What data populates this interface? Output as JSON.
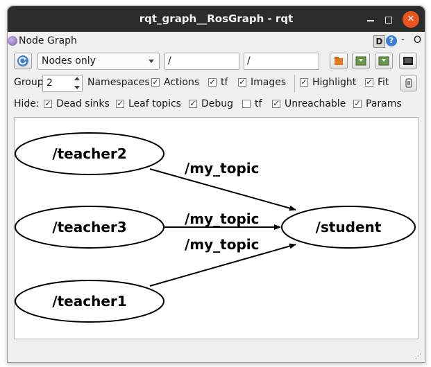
{
  "window": {
    "title": "rqt_graph__RosGraph - rqt",
    "minimize_glyph": "",
    "maximize_glyph": "",
    "close_glyph": "✕"
  },
  "plugin": {
    "title": "Node Graph",
    "icon": "node-graph-icon",
    "d_label": "D",
    "help_label": "?",
    "dash_label": "-",
    "close_label": "O"
  },
  "toolbar": {
    "refresh_icon": "refresh-icon",
    "mode_value": "Nodes only",
    "node_filter_value": "/",
    "topic_filter_value": "/",
    "buttons": [
      "load-dot-icon",
      "save-dot-icon",
      "save-svg-icon",
      "save-image-icon"
    ]
  },
  "group_row": {
    "group_label": "Group:",
    "group_value": "2",
    "namespaces": {
      "label": "Namespaces",
      "checked": true
    },
    "actions": {
      "label": "Actions",
      "checked": true
    },
    "tf": {
      "label": "tf",
      "checked": true
    },
    "images": {
      "label": "Images",
      "checked": true
    },
    "highlight": {
      "label": "Highlight",
      "checked": true
    },
    "fit": {
      "label": "Fit",
      "checked": true
    },
    "fit_button_icon": "fit-in-view-icon"
  },
  "hide_row": {
    "hide_label": "Hide:",
    "dead_sinks": {
      "label": "Dead sinks",
      "checked": true
    },
    "leaf_topics": {
      "label": "Leaf topics",
      "checked": true
    },
    "debug": {
      "label": "Debug",
      "checked": true
    },
    "tf": {
      "label": "tf",
      "checked": false
    },
    "unreachable": {
      "label": "Unreachable",
      "checked": true
    },
    "params": {
      "label": "Params",
      "checked": true
    }
  },
  "graph": {
    "nodes": [
      "/teacher2",
      "/teacher3",
      "/teacher1",
      "/student"
    ],
    "edges": [
      {
        "from": "/teacher2",
        "to": "/student",
        "label": "/my_topic"
      },
      {
        "from": "/teacher3",
        "to": "/student",
        "label": "/my_topic"
      },
      {
        "from": "/teacher1",
        "to": "/student",
        "label": "/my_topic"
      }
    ]
  },
  "checkmark": "✓",
  "colors": {
    "titlebar": "#2c2c2c",
    "close_button": "#e95420",
    "help_icon": "#3a7fd8"
  }
}
